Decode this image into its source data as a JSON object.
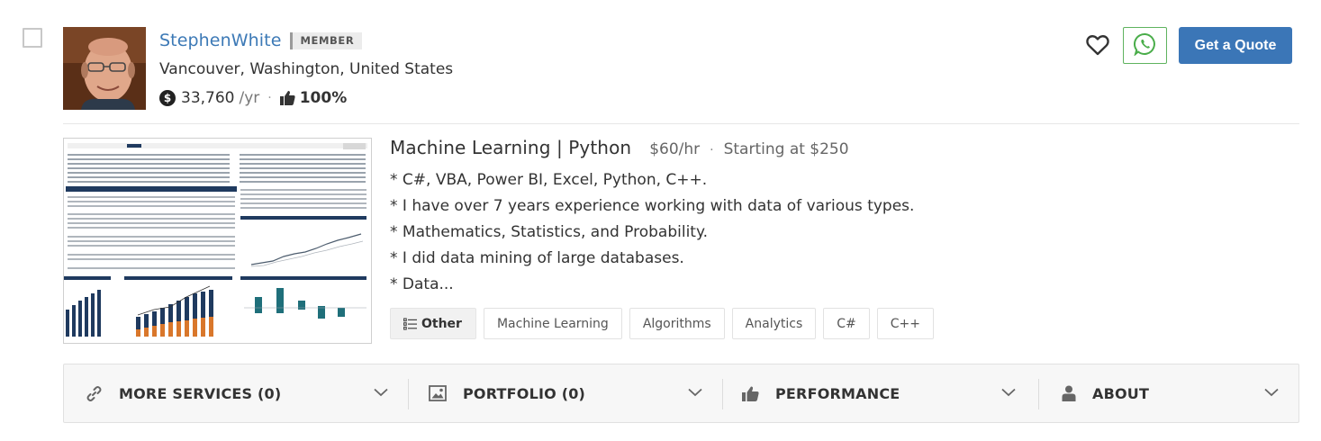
{
  "freelancer": {
    "name": "StephenWhite",
    "badge": "MEMBER",
    "location": "Vancouver, Washington, United States",
    "earnings": "33,760",
    "earnings_unit": "/yr",
    "rating": "100%"
  },
  "actions": {
    "quote_label": "Get a Quote",
    "favorite_icon": "heart-icon",
    "whatsapp_icon": "whatsapp-icon"
  },
  "service": {
    "title": "Machine Learning | Python",
    "rate": "$60/hr",
    "starting": "Starting at $250",
    "description": [
      "* C#, VBA, Power BI, Excel, Python, C++.",
      "* I have over 7 years experience working with data of various types.",
      "* Mathematics, Statistics, and Probability.",
      "* I did data mining of large databases.",
      "* Data..."
    ],
    "category": "Other",
    "tags": [
      "Machine Learning",
      "Algorithms",
      "Analytics",
      "C#",
      "C++"
    ]
  },
  "sections": [
    {
      "label": "MORE SERVICES (0)",
      "icon": "link-icon"
    },
    {
      "label": "PORTFOLIO (0)",
      "icon": "image-icon"
    },
    {
      "label": "PERFORMANCE",
      "icon": "thumbs-up-icon"
    },
    {
      "label": "ABOUT",
      "icon": "user-icon"
    }
  ],
  "colors": {
    "link": "#3c79b6",
    "primary_button": "#3b76b7",
    "whatsapp": "#5fb35f"
  }
}
